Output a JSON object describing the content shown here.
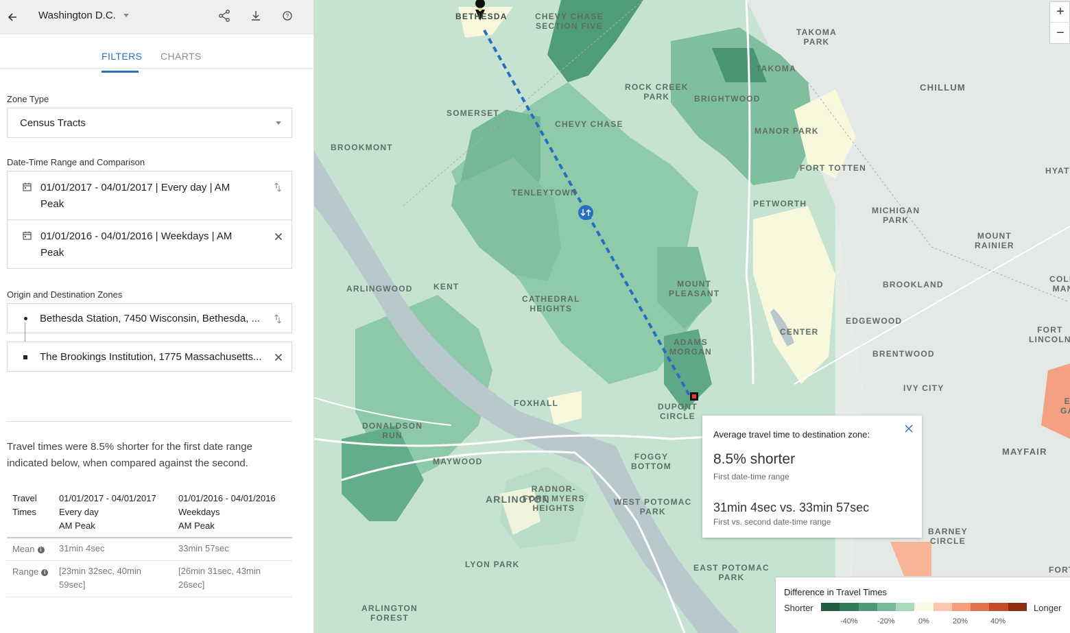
{
  "header": {
    "city": "Washington D.C.",
    "icons": [
      "back-arrow-icon",
      "share-icon",
      "download-icon",
      "help-icon"
    ]
  },
  "tabs": [
    {
      "label": "FILTERS",
      "active": true
    },
    {
      "label": "CHARTS",
      "active": false
    }
  ],
  "filters": {
    "zone_type_label": "Zone Type",
    "zone_type_value": "Census Tracts",
    "datetime_label": "Date-Time Range and Comparison",
    "range1_line1": "01/01/2017 - 04/01/2017 | Every day | AM",
    "range1_line2": "Peak",
    "range2_line1": "01/01/2016 - 04/01/2016 | Weekdays | AM",
    "range2_line2": "Peak",
    "od_label": "Origin and Destination Zones",
    "origin": "Bethesda Station, 7450 Wisconsin, Bethesda, ...",
    "destination": "The Brookings Institution, 1775 Massachusetts..."
  },
  "summary": {
    "text_line1": "Travel times were 8.5% shorter for the first date range",
    "text_line2": "indicated below, when compared against the second."
  },
  "stats_table": {
    "col0_line1": "Travel",
    "col0_line2": "Times",
    "col1": [
      "01/01/2017 - 04/01/2017",
      "Every day",
      "AM Peak"
    ],
    "col2": [
      "01/01/2016 - 04/01/2016",
      "Weekdays",
      "AM Peak"
    ],
    "rows": [
      {
        "label": "Mean",
        "v1_line1": "31min 4sec",
        "v1_line2": "",
        "v2_line1": "33min 57sec",
        "v2_line2": ""
      },
      {
        "label": "Range",
        "v1_line1": "[23min 32sec, 40min",
        "v1_line2": "59sec]",
        "v2_line1": "[26min 31sec, 43min",
        "v2_line2": "26sec]"
      }
    ]
  },
  "map": {
    "places": {
      "bethesda": "BETHESDA",
      "chevy_chase_five": "CHEVY CHASE\nSECTION FIVE",
      "takoma_park": "TAKOMA\nPARK",
      "takoma": "TAKOMA",
      "chillum": "CHILLUM",
      "rock_creek_park": "ROCK CREEK\nPARK",
      "brightwood": "BRIGHTWOOD",
      "somerset": "SOMERSET",
      "chevy_chase": "CHEVY CHASE",
      "manor_park": "MANOR PARK",
      "brookmont": "BROOKMONT",
      "fort_totten": "FORT TOTTEN",
      "hyatt": "HYATT",
      "tenleytown": "TENLEYTOWN",
      "petworth": "PETWORTH",
      "michigan_park": "MICHIGAN\nPARK",
      "mount_rainier": "MOUNT\nRAINIER",
      "arlingwood": "ARLINGWOOD",
      "kent": "KENT",
      "mount_pleasant": "MOUNT\nPLEASANT",
      "brookland": "BROOKLAND",
      "colm": "COLM\nMAN",
      "cathedral_heights": "CATHEDRAL\nHEIGHTS",
      "edgewood": "EDGEWOOD",
      "center": "CENTER",
      "fort_lincoln": "FORT\nLINCOLN",
      "adams_morgan": "ADAMS\nMORGAN",
      "brentwood": "BRENTWOOD",
      "ivy_city": "IVY CITY",
      "foxhall": "FOXHALL",
      "dupont_circle": "DUPONT\nCIRCLE",
      "ga": "E\nGA",
      "donaldson_run": "DONALDSON\nRUN",
      "mayfair": "MAYFAIR",
      "foggy_bottom": "FOGGY\nBOTTOM",
      "maywood": "MAYWOOD",
      "radnor": "RADNOR-\nFORT MYERS\nHEIGHTS",
      "arlington": "ARLINGTON",
      "west_potomac": "WEST POTOMAC\nPARK",
      "barney_circle": "BARNEY\nCIRCLE",
      "lyon_park": "LYON PARK",
      "east_potomac": "EAST POTOMAC\nPARK",
      "fort": "FORT",
      "arlington_forest": "ARLINGTON\nFOREST"
    },
    "zoom_in": "+",
    "zoom_out": "−"
  },
  "popup": {
    "title": "Average travel time to destination zone:",
    "big": "8.5% shorter",
    "sub": "First date-time range",
    "compare": "31min 4sec vs. 33min 57sec",
    "compare_sub": "First vs. second date-time range"
  },
  "legend": {
    "title": "Difference in Travel Times",
    "shorter": "Shorter",
    "longer": "Longer",
    "colors": [
      "#1f5c41",
      "#2f7d57",
      "#4a9a72",
      "#78b99a",
      "#a9d8bd",
      "#fbfbe5",
      "#fbc6b0",
      "#f49e7e",
      "#e2734f",
      "#c64c25",
      "#8f2d10"
    ],
    "ticks": [
      "-40%",
      "-20%",
      "0%",
      "20%",
      "40%"
    ]
  }
}
